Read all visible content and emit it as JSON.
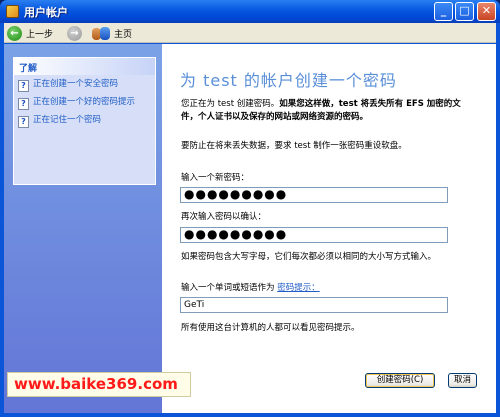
{
  "window": {
    "title": "用户帐户"
  },
  "toolbar": {
    "back_label": "上一步",
    "home_label": "主页"
  },
  "sidebar": {
    "learn_title": "了解",
    "items": [
      {
        "label": "正在创建一个安全密码"
      },
      {
        "label": "正在创建一个好的密码提示"
      },
      {
        "label": "正在记住一个密码"
      }
    ]
  },
  "main": {
    "heading": "为 test 的帐户创建一个密码",
    "intro_normal": "您正在为 test 创建密码。",
    "intro_bold": "如果您这样做，test 将丢失所有 EFS 加密的文件，个人证书以及保存的网站或网络资源的密码。",
    "reset_note": "要防止在将来丢失数据，要求 test 制作一张密码重设软盘。",
    "new_password_label": "输入一个新密码：",
    "new_password_value": "●●●●●●●●●",
    "confirm_label": "再次输入密码以确认：",
    "confirm_value": "●●●●●●●●●",
    "case_note": "如果密码包含大写字母，它们每次都必须以相同的大小写方式输入。",
    "hint_prefix": "输入一个单词或短语作为",
    "hint_link": "密码提示：",
    "hint_value": "GeTi",
    "hint_visible_note": "所有使用这台计算机的人都可以看见密码提示。",
    "create_button": "创建密码(C)",
    "cancel_button": "取消"
  },
  "watermark": "www.baike369.com"
}
